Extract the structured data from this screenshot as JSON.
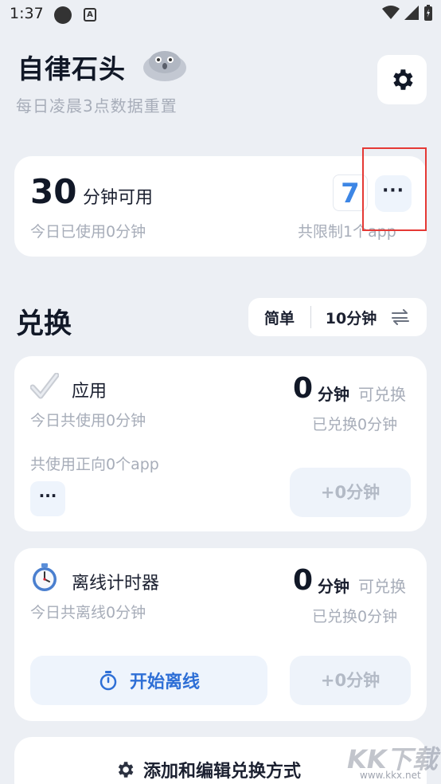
{
  "status_bar": {
    "time": "1:37",
    "a_icon": "A"
  },
  "header": {
    "title": "自律石头",
    "subtitle": "每日凌晨3点数据重置"
  },
  "summary": {
    "minutes": "30",
    "minutes_label": "分钟可用",
    "used_today": "今日已使用0分钟",
    "limit_total": "共限制1个app",
    "badge": "7",
    "more": "···"
  },
  "exchange": {
    "title": "兑换",
    "mode": "简单",
    "duration": "10分钟"
  },
  "apps_card": {
    "title": "应用",
    "usage": "今日共使用0分钟",
    "positive": "共使用正向0个app",
    "minutes": "0",
    "unit": "分钟",
    "exchangeable": "可兑换",
    "exchanged": "已兑换0分钟",
    "add_button": "+0分钟",
    "more": "···"
  },
  "offline_card": {
    "title": "离线计时器",
    "usage": "今日共离线0分钟",
    "minutes": "0",
    "unit": "分钟",
    "exchangeable": "可兑换",
    "exchanged": "已兑换0分钟",
    "add_button": "+0分钟",
    "start_button": "开始离线"
  },
  "footer": {
    "edit_label": "添加和编辑兑换方式"
  },
  "watermark": {
    "brand": "KK下载",
    "url": "www.kkx.net"
  },
  "colors": {
    "accent": "#2e6fd6",
    "badge": "#3d86e5",
    "highlight": "#e53935"
  }
}
